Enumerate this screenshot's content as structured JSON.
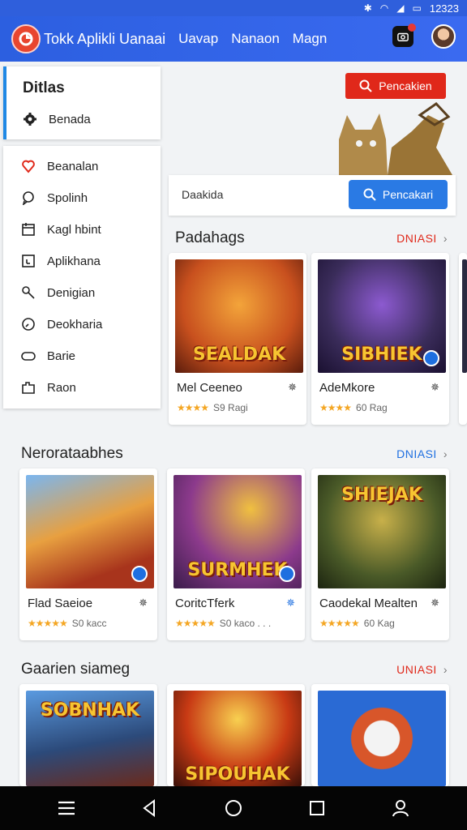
{
  "status_bar": {
    "time": "12323"
  },
  "app_bar": {
    "title": "Tokk Aplikli Uanaai",
    "nav": [
      "Uavap",
      "Nanaon",
      "Magn"
    ]
  },
  "dropdown": {
    "title": "Ditlas",
    "selected": {
      "label": "Benada",
      "icon": "gear-icon"
    },
    "items": [
      {
        "label": "Beanalan",
        "icon": "heart-icon"
      },
      {
        "label": "Spolinh",
        "icon": "chat-icon"
      },
      {
        "label": "Kagl hbint",
        "icon": "calendar-icon"
      },
      {
        "label": "Aplikhana",
        "icon": "app-icon"
      },
      {
        "label": "Denigian",
        "icon": "key-icon"
      },
      {
        "label": "Deokharia",
        "icon": "clock-icon"
      },
      {
        "label": "Barie",
        "icon": "gamepad-icon"
      },
      {
        "label": "Raon",
        "icon": "puzzle-icon"
      }
    ]
  },
  "hero": {
    "search_label": "Pencakien"
  },
  "search": {
    "label": "Daakida",
    "button_label": "Pencakari"
  },
  "sections": [
    {
      "title": "Padahags",
      "more": "DNIASI",
      "more_color": "#e0281a",
      "cards": [
        {
          "name": "Mel Ceeneo",
          "rating": "S9 Ragi",
          "art": "SEALDAK",
          "art_bg": "#c8501e",
          "badge": false
        },
        {
          "name": "AdeMkore",
          "rating": "60 Rag",
          "art": "SIBHIEK",
          "art_bg": "#3a2c5a",
          "badge": true
        }
      ]
    },
    {
      "title": "Nerorataabhes",
      "more": "DNIASI",
      "more_color": "#1e6fe0",
      "cards": [
        {
          "name": "Flad Saeioe",
          "rating": "S0 kacc",
          "art": "",
          "art_bg": "#d6612c",
          "badge": true
        },
        {
          "name": "CoritcTferk",
          "rating": "S0 kaco . . .",
          "art": "SURMHEK",
          "art_bg": "#5a2c6a",
          "badge": true
        },
        {
          "name": "Caodekal Mealten",
          "rating": "60 Kag",
          "art": "SHIEJAK",
          "art_bg": "#4a5a28",
          "badge": false
        }
      ]
    },
    {
      "title": "Gaarien siameg",
      "more": "UNIASI",
      "more_color": "#e0281a",
      "cards": [
        {
          "art": "SOBNHAK",
          "art_bg": "#2c4a7a"
        },
        {
          "art": "SIPOUHAK",
          "art_bg": "#c83a14"
        },
        {
          "art": "",
          "art_bg": "#2a6ad4"
        }
      ]
    }
  ],
  "bottom_nav": [
    "menu-icon",
    "back-icon",
    "home-icon",
    "recents-icon",
    "profile-icon"
  ],
  "colors": {
    "primary": "#2c5fe0",
    "accent_red": "#e0281a",
    "accent_blue": "#2a7ae4",
    "star": "#f4a623"
  }
}
